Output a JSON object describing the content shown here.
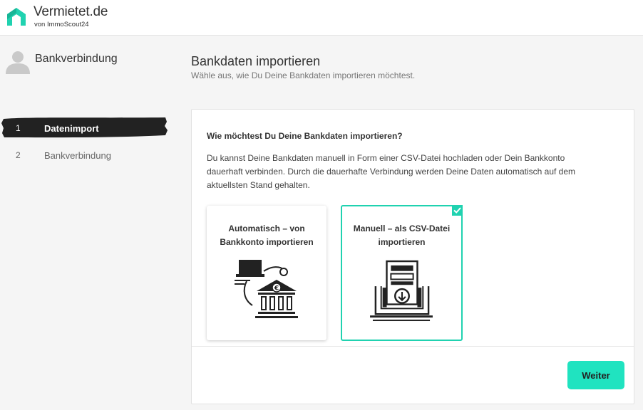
{
  "brand": {
    "name": "Vermietet.de",
    "sub": "von ImmoScout24",
    "color": "#20d2b0"
  },
  "sidebar": {
    "title": "Bankverbindung",
    "steps": [
      {
        "num": "1",
        "label": "Datenimport",
        "active": true
      },
      {
        "num": "2",
        "label": "Bankverbindung",
        "active": false
      }
    ]
  },
  "main": {
    "title": "Bankdaten importieren",
    "subtitle": "Wähle aus, wie Du Deine Bankdaten importieren möchtest.",
    "question": "Wie möchtest Du Deine Bankdaten importieren?",
    "description": "Du kannst Deine Bankdaten manuell in Form einer CSV-Datei hochladen oder Dein Bankkonto dauerhaft verbinden. Durch die dauerhafte Verbindung werden Deine Daten automatisch auf dem aktuellsten Stand gehalten.",
    "options": [
      {
        "label": "Automatisch – von Bankkonto importieren",
        "icon": "bank-connection-icon",
        "selected": false
      },
      {
        "label": "Manuell – als CSV-Datei importieren",
        "icon": "csv-upload-icon",
        "selected": true
      }
    ],
    "next_label": "Weiter"
  },
  "colors": {
    "accent": "#20d2b0",
    "button": "#20e3c0",
    "active_step": "#222222"
  }
}
